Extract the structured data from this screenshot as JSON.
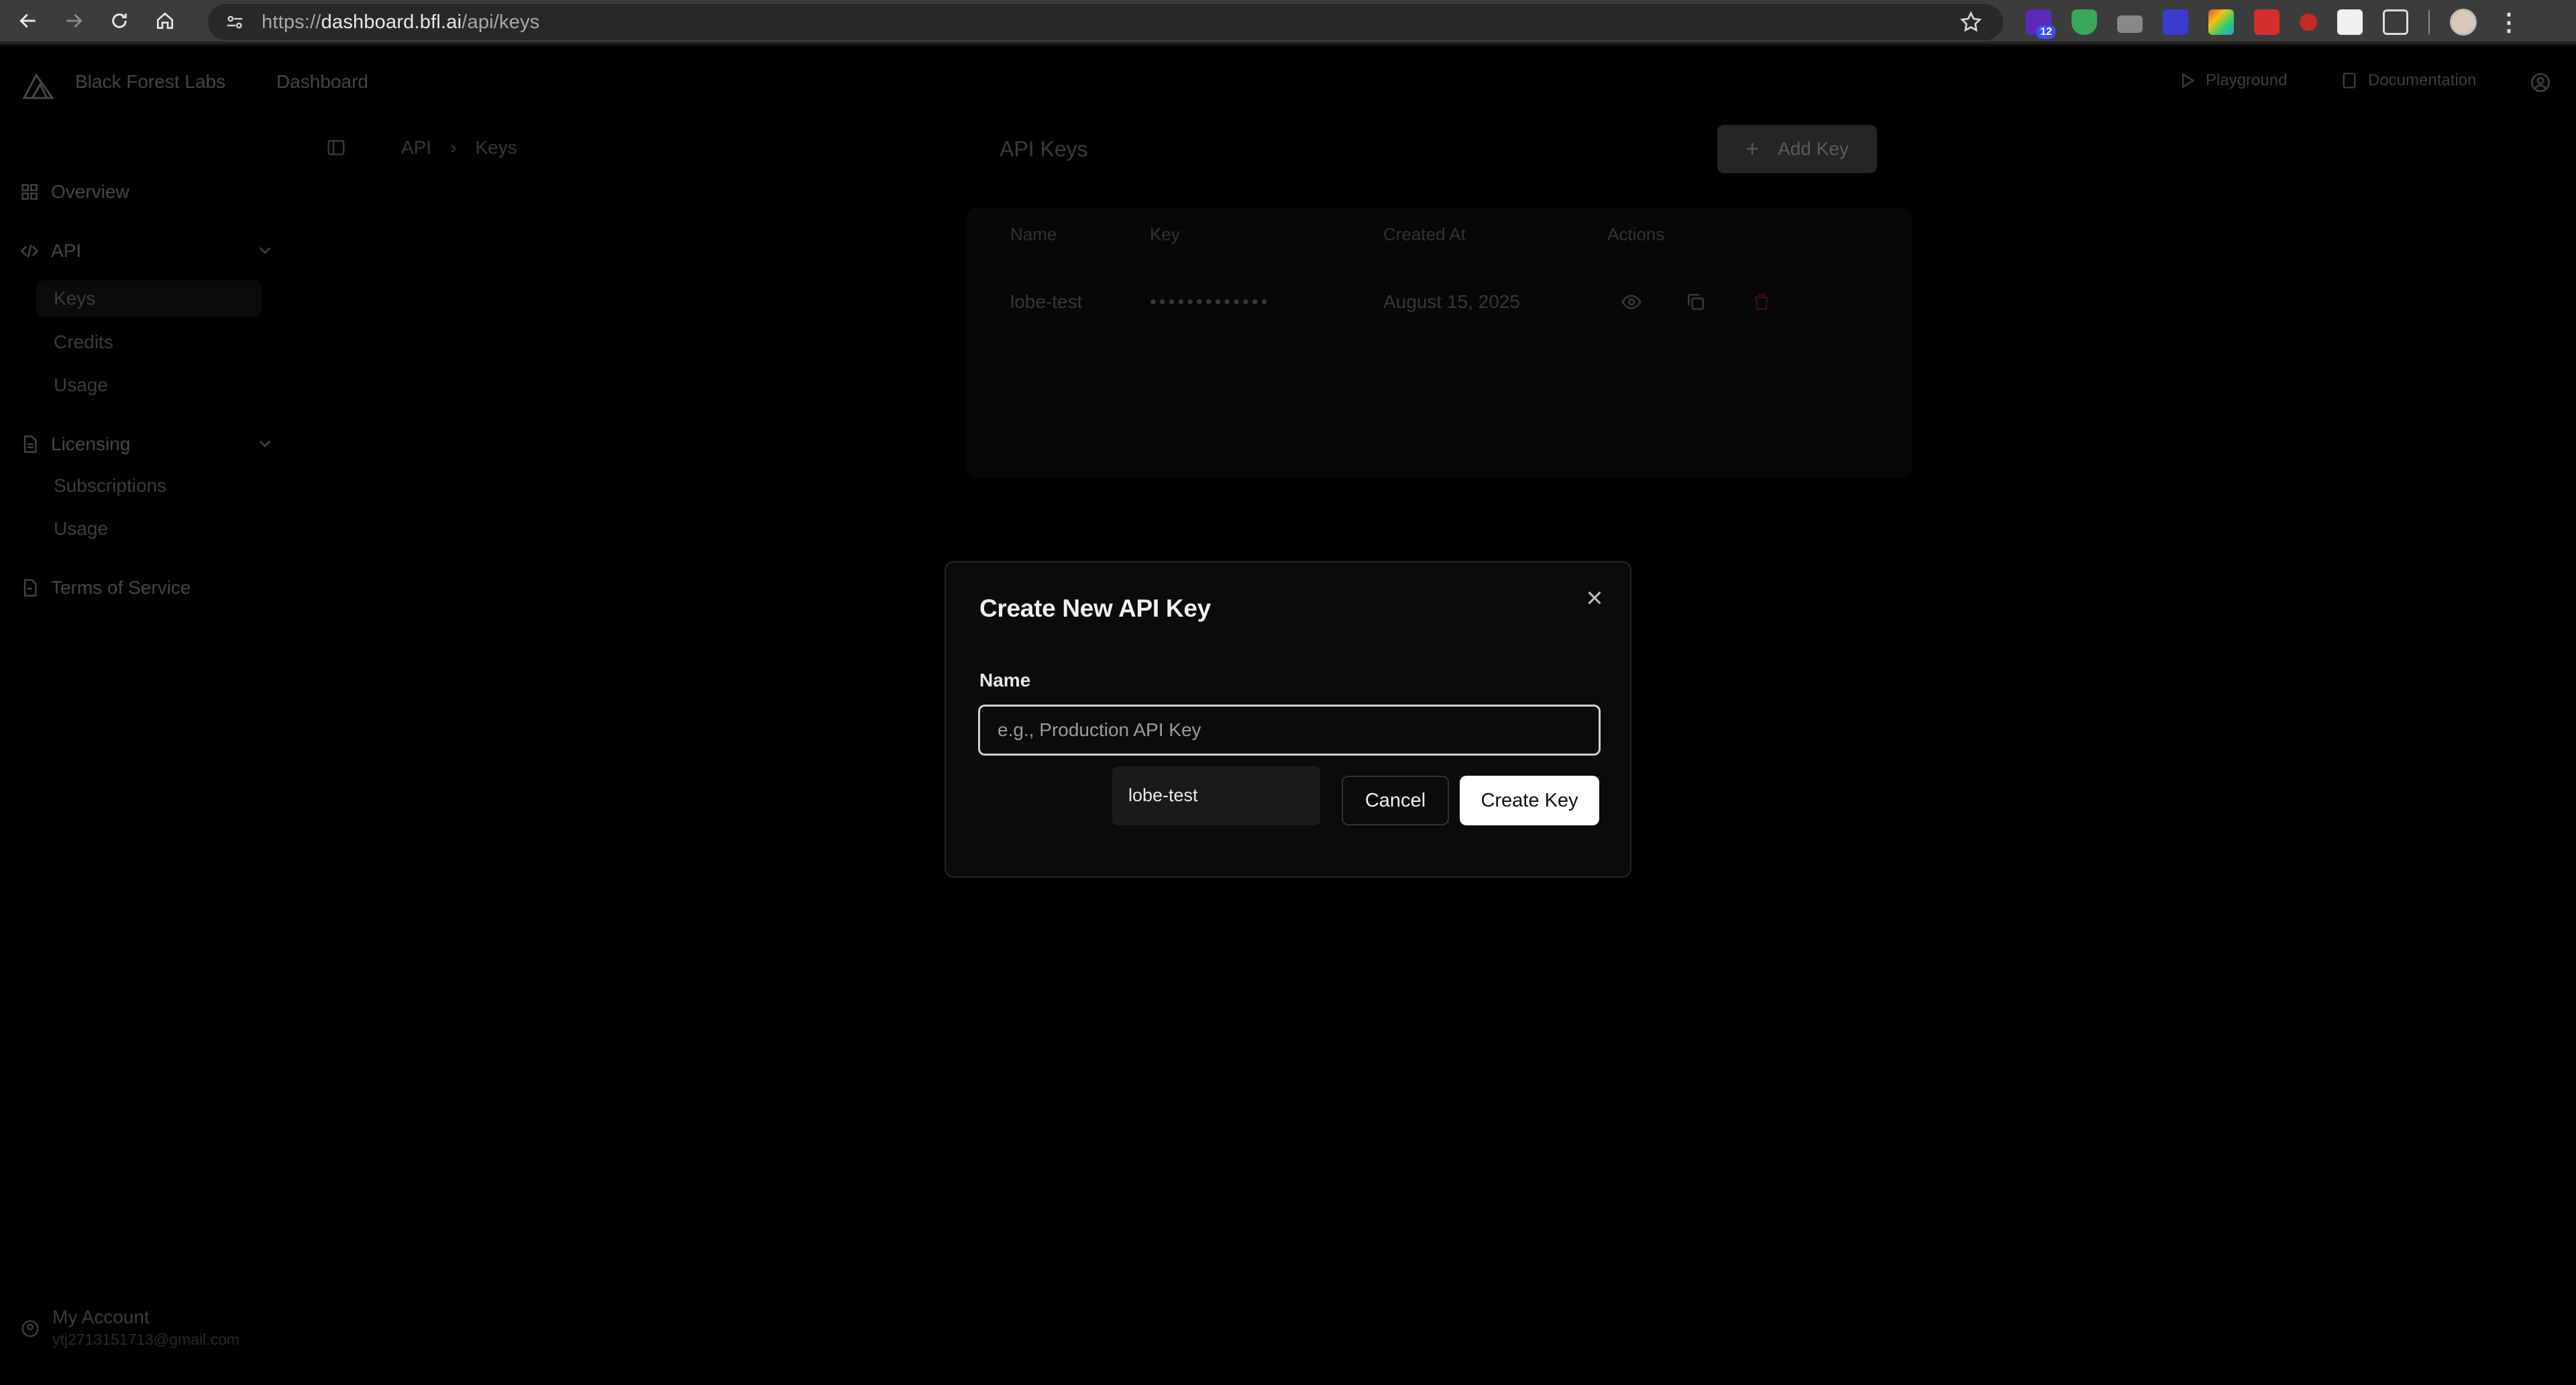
{
  "browser": {
    "url_prefix": "https://",
    "url_host": "dashboard.bfl.ai",
    "url_path": "/api/keys",
    "ext_badge": "12"
  },
  "header": {
    "brand": "Black Forest Labs",
    "section": "Dashboard",
    "playground": "Playground",
    "documentation": "Documentation"
  },
  "sidebar": {
    "overview": "Overview",
    "api": "API",
    "api_items": [
      "Keys",
      "Credits",
      "Usage"
    ],
    "licensing": "Licensing",
    "licensing_items": [
      "Subscriptions",
      "Usage"
    ],
    "terms": "Terms of Service",
    "account_name": "My Account",
    "account_email": "ytj2713151713@gmail.com"
  },
  "breadcrumb": [
    "API",
    "Keys"
  ],
  "keys_card": {
    "title": "API Keys",
    "add_label": "Add Key",
    "columns": [
      "Name",
      "Key",
      "Created At",
      "Actions"
    ],
    "rows": [
      {
        "name": "lobe-test",
        "key": "•••••••••••••",
        "created": "August 15, 2025"
      }
    ]
  },
  "modal": {
    "title": "Create New API Key",
    "name_label": "Name",
    "name_value": "",
    "name_placeholder": "e.g., Production API Key",
    "autofill_suggestion": "lobe-test",
    "cancel_label": "Cancel",
    "create_label": "Create Key"
  },
  "colors": {
    "background": "#000000",
    "modal_bg": "#0b0b0b",
    "primary_button": "#ffffff",
    "delete_icon": "#5a1414"
  }
}
